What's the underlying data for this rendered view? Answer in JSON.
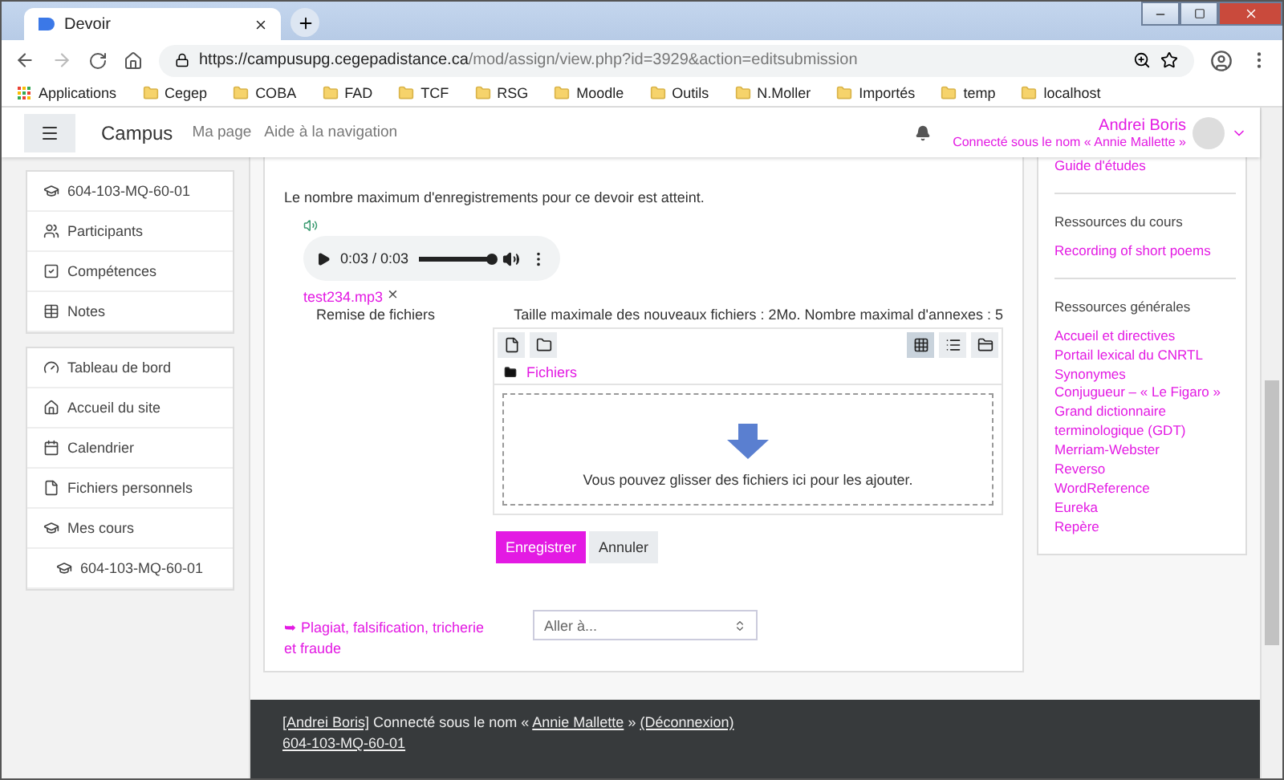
{
  "browser": {
    "tab_title": "Devoir",
    "url_host": "https://campusupg.cegepadistance.ca",
    "url_path": "/mod/assign/view.php?id=3929&action=editsubmission",
    "bookmarks": [
      {
        "kind": "apps",
        "label": "Applications"
      },
      {
        "kind": "folder",
        "label": "Cegep"
      },
      {
        "kind": "folder",
        "label": "COBA"
      },
      {
        "kind": "folder",
        "label": "FAD"
      },
      {
        "kind": "folder",
        "label": "TCF"
      },
      {
        "kind": "folder",
        "label": "RSG"
      },
      {
        "kind": "folder",
        "label": "Moodle"
      },
      {
        "kind": "folder",
        "label": "Outils"
      },
      {
        "kind": "folder",
        "label": "N.Moller"
      },
      {
        "kind": "folder",
        "label": "Importés"
      },
      {
        "kind": "folder",
        "label": "temp"
      },
      {
        "kind": "folder",
        "label": "localhost"
      }
    ]
  },
  "header": {
    "site_name": "Campus",
    "links": [
      "Ma page",
      "Aide à la navigation"
    ],
    "user_name": "Andrei Boris",
    "logged_in_as": "Connecté sous le nom « Annie Mallette »"
  },
  "nav_blocks": [
    {
      "items": [
        {
          "label": "604-103-MQ-60-01"
        },
        {
          "label": "Participants"
        },
        {
          "label": "Compétences"
        },
        {
          "label": "Notes"
        }
      ]
    },
    {
      "items": [
        {
          "label": "Tableau de bord"
        },
        {
          "label": "Accueil du site"
        },
        {
          "label": "Calendrier"
        },
        {
          "label": "Fichiers personnels"
        },
        {
          "label": "Mes cours",
          "children": [
            {
              "label": "604-103-MQ-60-01"
            }
          ]
        }
      ]
    }
  ],
  "main": {
    "notice": "Le nombre maximum d'enregistrements pour ce devoir est atteint.",
    "audio": {
      "time": "0:03 / 0:03",
      "level": 1
    },
    "file_link": "test234.mp3",
    "remove": "×",
    "file_field": {
      "label": "Remise de fichiers",
      "limits": "Taille maximale des nouveaux fichiers : 2Mo. Nombre maximal d'annexes : 5",
      "views": [
        {
          "selected": true
        },
        {
          "selected": false
        },
        {
          "selected": false
        }
      ],
      "path": "Fichiers",
      "drop_hint": "Vous pouvez glisser des fichiers ici pour les ajouter."
    },
    "buttons": [
      {
        "kind": "primary",
        "label": "Enregistrer"
      },
      {
        "kind": "secondary",
        "label": "Annuler"
      }
    ],
    "prev_link": "➥ Plagiat, falsification, tricherie et fraude",
    "jump_placeholder": "Aller à..."
  },
  "side_block": {
    "top_link": "Guide d'études",
    "sections": [
      {
        "title": "Ressources du cours",
        "links": [
          "Recording of short poems"
        ]
      },
      {
        "title": "Ressources générales",
        "links": [
          "Accueil et directives",
          "Portail lexical du CNRTL",
          "Synonymes",
          "Conjugueur – « Le Figaro »",
          "Grand dictionnaire terminologique (GDT)",
          "Merriam-Webster",
          "Reverso",
          "WordReference",
          "Eureka",
          "Repère"
        ]
      }
    ]
  },
  "footer": {
    "user_link": "[Andrei Boris]",
    "connected_as": "Connecté sous le nom «",
    "login_name": "Annie Mallette",
    "closing": "»",
    "logout": "(Déconnexion)",
    "course_link": "604-103-MQ-60-01"
  }
}
